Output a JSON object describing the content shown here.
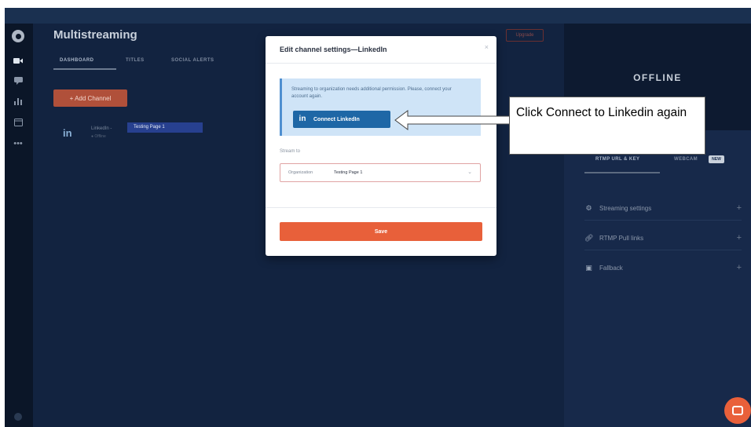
{
  "app": {
    "title": "Multistreaming",
    "upgrade_label": "Upgrade"
  },
  "sidebar": {
    "icons": [
      "logo-icon",
      "camera-icon",
      "chat-icon",
      "chart-icon",
      "calendar-icon",
      "more-icon"
    ]
  },
  "main": {
    "tabs": [
      {
        "label": "DASHBOARD"
      },
      {
        "label": "TITLES"
      },
      {
        "label": "SOCIAL ALERTS"
      }
    ],
    "add_channel_label": "+ Add Channel",
    "channel": {
      "name": "LinkedIn -",
      "status": "● Offline",
      "target": "Testing Page 1"
    }
  },
  "right_panel": {
    "status": "OFFLINE",
    "tabs": [
      {
        "label": "RTMP URL & KEY"
      },
      {
        "label": "WEBCAM"
      }
    ],
    "new_badge": "NEW",
    "rows": [
      {
        "label": "Streaming settings"
      },
      {
        "label": "RTMP Pull links"
      },
      {
        "label": "Fallback"
      }
    ]
  },
  "modal": {
    "title": "Edit channel settings—LinkedIn",
    "alert_text": "Streaming to organization needs additional permission. Please, connect your account again.",
    "connect_label": "Connect LinkedIn",
    "stream_to_label": "Stream to",
    "org_key": "Organization",
    "org_value": "Testing Page 1",
    "save_label": "Save"
  },
  "callout": {
    "text": "Click Connect to Linkedin again"
  },
  "colors": {
    "accent": "#e8603a",
    "linkedin": "#1e67a6",
    "background": "#122340"
  }
}
